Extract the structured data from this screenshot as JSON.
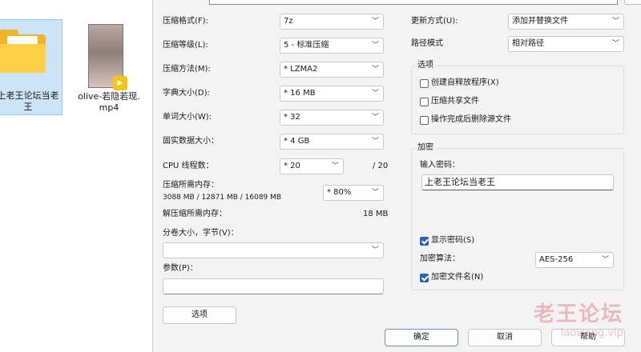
{
  "explorer": {
    "files": [
      {
        "name": "上老王论坛当老\n王"
      },
      {
        "name": "olive-若隐若现.\nmp4",
        "badge": "Player"
      }
    ]
  },
  "left": {
    "format": {
      "label": "压缩格式(F):",
      "value": "7z"
    },
    "level": {
      "label": "压缩等级(L):",
      "value": "5 - 标准压缩"
    },
    "method": {
      "label": "压缩方法(M):",
      "value": "* LZMA2"
    },
    "dict": {
      "label": "字典大小(D):",
      "value": "* 16 MB"
    },
    "word": {
      "label": "单词大小(W):",
      "value": "* 32"
    },
    "solid": {
      "label": "固实数据大小：",
      "value": "* 4 GB"
    },
    "threads": {
      "label": "CPU 线程数：",
      "value": "* 20",
      "max": "/ 20"
    },
    "mem": {
      "label": "压缩所需内存：",
      "detail": "3088 MB / 12871 MB / 16089 MB",
      "value": "* 80%"
    },
    "decomp": {
      "label": "解压缩所需内存：",
      "value": "18 MB"
    },
    "split": {
      "label": "分卷大小，字节(V)：",
      "value": ""
    },
    "params": {
      "label": "参数(P)：",
      "value": ""
    },
    "options_button": "选项"
  },
  "right": {
    "update": {
      "label": "更新方式(U):",
      "value": "添加并替换文件"
    },
    "path": {
      "label": "路径模式",
      "value": "相对路径"
    },
    "options": {
      "title": "选项",
      "items": [
        {
          "label": "创建自释放程序(X)",
          "checked": false
        },
        {
          "label": "压缩共享文件",
          "checked": false
        },
        {
          "label": "操作完成后删除源文件",
          "checked": false
        }
      ]
    },
    "encryption": {
      "title": "加密",
      "password_label": "输入密码：",
      "password": "上老王论坛当老王",
      "show_password": {
        "label": "显示密码(S)",
        "checked": true
      },
      "method_label": "加密算法：",
      "method": "AES-256",
      "encrypt_names": {
        "label": "加密文件名(N)",
        "checked": true
      }
    }
  },
  "buttons": {
    "ok": "确定",
    "cancel": "取消",
    "help": "帮助"
  },
  "watermark": {
    "line1": "老王论坛",
    "line2": "laowang.vip"
  },
  "icons": {
    "dropdown": "chevron-down-icon"
  }
}
